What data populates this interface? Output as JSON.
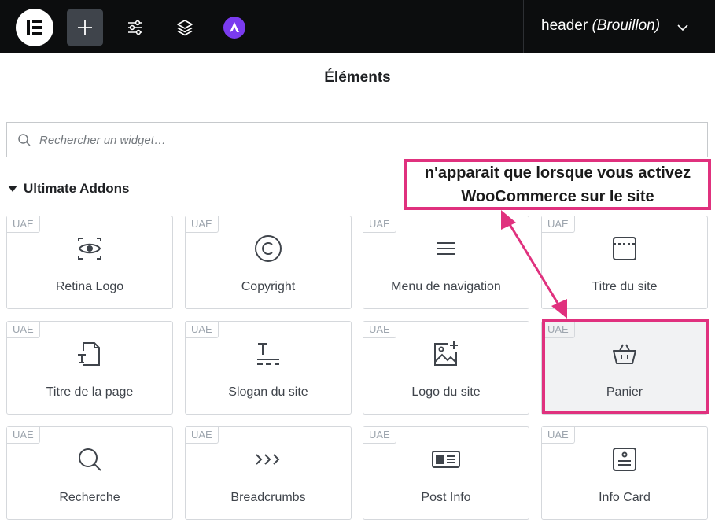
{
  "topbar": {
    "document_name": "header",
    "document_status": "(Brouillon)",
    "icons": [
      "elementor-logo-icon",
      "add-element-icon",
      "site-settings-icon",
      "structure-layers-icon",
      "astra-icon",
      "chevron-down-icon"
    ],
    "colors": {
      "background": "#0c0d0e",
      "active_button": "#3f444b",
      "astra": "#7a3bef"
    }
  },
  "panel": {
    "title": "Éléments",
    "search_placeholder": "Rechercher un widget…"
  },
  "category": {
    "name": "Ultimate Addons"
  },
  "widgets": [
    {
      "label": "Retina Logo",
      "badge": "UAE",
      "icon": "retina-logo-icon"
    },
    {
      "label": "Copyright",
      "badge": "UAE",
      "icon": "copyright-icon"
    },
    {
      "label": "Menu de navigation",
      "badge": "UAE",
      "icon": "menu-icon"
    },
    {
      "label": "Titre du site",
      "badge": "UAE",
      "icon": "site-title-icon"
    },
    {
      "label": "Titre de la page",
      "badge": "UAE",
      "icon": "page-title-icon"
    },
    {
      "label": "Slogan du site",
      "badge": "UAE",
      "icon": "site-tagline-icon"
    },
    {
      "label": "Logo du site",
      "badge": "UAE",
      "icon": "site-logo-icon"
    },
    {
      "label": "Panier",
      "badge": "UAE",
      "icon": "cart-basket-icon"
    },
    {
      "label": "Recherche",
      "badge": "UAE",
      "icon": "search-icon"
    },
    {
      "label": "Breadcrumbs",
      "badge": "UAE",
      "icon": "breadcrumbs-icon"
    },
    {
      "label": "Post Info",
      "badge": "UAE",
      "icon": "post-info-icon"
    },
    {
      "label": "Info Card",
      "badge": "UAE",
      "icon": "info-card-icon"
    }
  ],
  "annotation": {
    "line1": "n'apparait que lorsque vous activez",
    "line2": "WooCommerce sur le site",
    "color": "#e0317e"
  }
}
